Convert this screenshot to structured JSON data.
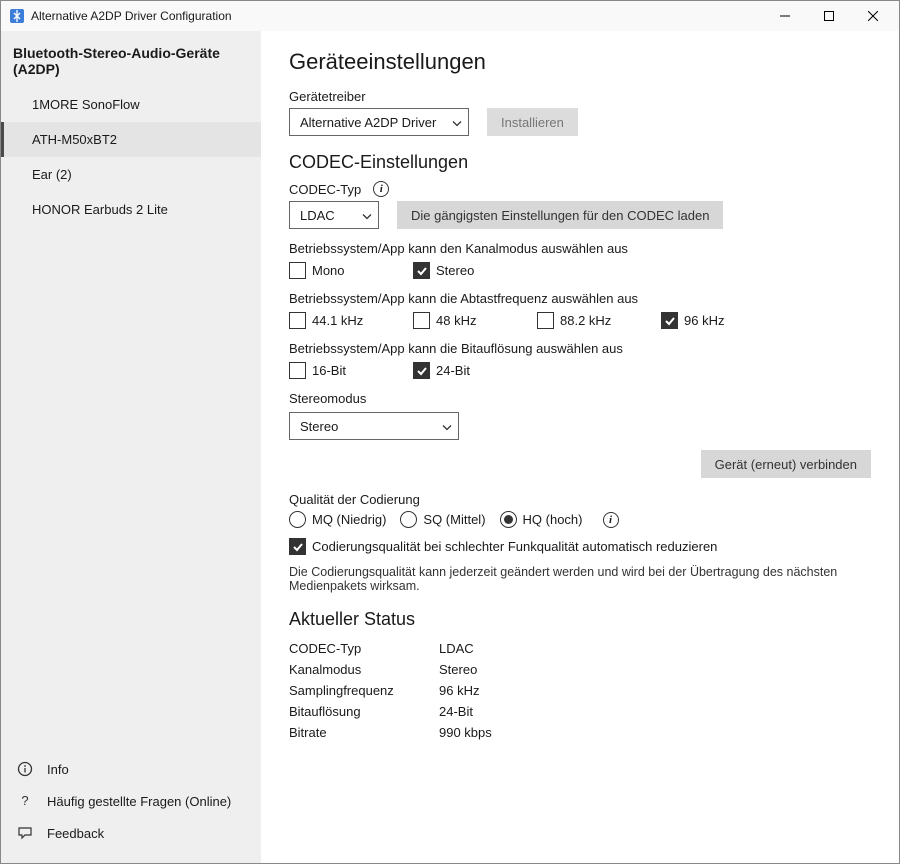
{
  "window": {
    "title": "Alternative A2DP Driver Configuration"
  },
  "sidebar": {
    "header": "Bluetooth-Stereo-Audio-Geräte (A2DP)",
    "devices": [
      {
        "name": "1MORE SonoFlow",
        "selected": false
      },
      {
        "name": "ATH-M50xBT2",
        "selected": true
      },
      {
        "name": "Ear (2)",
        "selected": false
      },
      {
        "name": "HONOR Earbuds 2 Lite",
        "selected": false
      }
    ],
    "footer": {
      "info": "Info",
      "faq": "Häufig gestellte Fragen (Online)",
      "feedback": "Feedback"
    }
  },
  "main": {
    "settings_title": "Geräteeinstellungen",
    "driver_label": "Gerätetreiber",
    "driver_value": "Alternative A2DP Driver",
    "install_btn": "Installieren",
    "codec_title": "CODEC-Einstellungen",
    "codec_type_label": "CODEC-Typ",
    "codec_type_value": "LDAC",
    "load_defaults_btn": "Die gängigsten Einstellungen für den CODEC laden",
    "chanmode_label": "Betriebssystem/App kann den Kanalmodus auswählen aus",
    "chan_mono": "Mono",
    "chan_stereo": "Stereo",
    "chan_mono_checked": false,
    "chan_stereo_checked": true,
    "sample_label": "Betriebssystem/App kann die Abtastfrequenz auswählen aus",
    "rates": [
      {
        "label": "44.1 kHz",
        "checked": false
      },
      {
        "label": "48 kHz",
        "checked": false
      },
      {
        "label": "88.2 kHz",
        "checked": false
      },
      {
        "label": "96 kHz",
        "checked": true
      }
    ],
    "bit_label": "Betriebssystem/App kann die Bitauflösung auswählen aus",
    "bits": [
      {
        "label": "16-Bit",
        "checked": false
      },
      {
        "label": "24-Bit",
        "checked": true
      }
    ],
    "stereo_mode_label": "Stereomodus",
    "stereo_mode_value": "Stereo",
    "reconnect_btn": "Gerät (erneut) verbinden",
    "quality_label": "Qualität der Codierung",
    "quality_options": [
      {
        "label": "MQ (Niedrig)",
        "checked": false
      },
      {
        "label": "SQ (Mittel)",
        "checked": false
      },
      {
        "label": "HQ (hoch)",
        "checked": true
      }
    ],
    "auto_reduce_label": "Codierungsqualität bei schlechter Funkqualität automatisch reduzieren",
    "auto_reduce_checked": true,
    "quality_note": "Die Codierungsqualität kann jederzeit geändert werden und wird bei der Übertragung des nächsten Medienpakets wirksam.",
    "status_title": "Aktueller Status",
    "status": [
      {
        "k": "CODEC-Typ",
        "v": "LDAC"
      },
      {
        "k": "Kanalmodus",
        "v": "Stereo"
      },
      {
        "k": "Samplingfrequenz",
        "v": "96 kHz"
      },
      {
        "k": "Bitauflösung",
        "v": "24-Bit"
      },
      {
        "k": "Bitrate",
        "v": "990 kbps"
      }
    ]
  }
}
